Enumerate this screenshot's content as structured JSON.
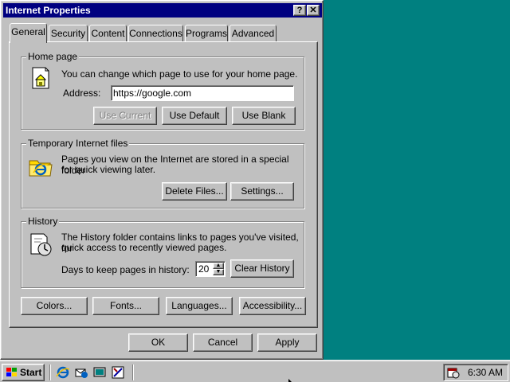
{
  "window": {
    "title": "Internet Properties",
    "help_glyph": "?",
    "close_glyph": "✕"
  },
  "tabs": [
    {
      "label": "General",
      "active": true
    },
    {
      "label": "Security"
    },
    {
      "label": "Content"
    },
    {
      "label": "Connections"
    },
    {
      "label": "Programs"
    },
    {
      "label": "Advanced"
    }
  ],
  "home_page": {
    "group_label": "Home page",
    "description": "You can change which page to use for your home page.",
    "address_label": "Address:",
    "address_value": "https://google.com",
    "use_current": "Use Current",
    "use_default": "Use Default",
    "use_blank": "Use Blank"
  },
  "temp_files": {
    "group_label": "Temporary Internet files",
    "description_line1": "Pages you view on the Internet are stored in a special folder",
    "description_line2": "for quick viewing later.",
    "delete_files": "Delete Files...",
    "settings": "Settings..."
  },
  "history": {
    "group_label": "History",
    "description_line1": "The History folder contains links to pages you've visited, for",
    "description_line2": "quick access to recently viewed pages.",
    "days_label": "Days to keep pages in history:",
    "days_value": "20",
    "clear_history": "Clear History"
  },
  "bottom_buttons": {
    "colors": "Colors...",
    "fonts": "Fonts...",
    "languages": "Languages...",
    "accessibility": "Accessibility..."
  },
  "dialog_buttons": {
    "ok": "OK",
    "cancel": "Cancel",
    "apply": "Apply"
  },
  "taskbar": {
    "start_label": "Start",
    "clock": "6:30 AM"
  },
  "colors": {
    "desktop": "#008080",
    "title_bar": "#000080",
    "face": "#c0c0c0"
  }
}
